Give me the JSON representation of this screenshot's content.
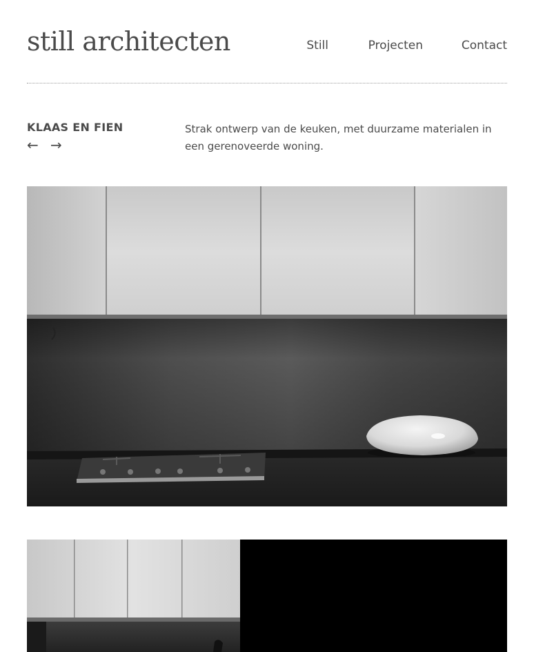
{
  "header": {
    "logo": "still architecten",
    "nav": [
      "Still",
      "Projecten",
      "Contact"
    ]
  },
  "project": {
    "title": "KLAAS EN FIEN",
    "prev_arrow": "←",
    "next_arrow": "→",
    "description": "Strak ontwerp van de keuken, met duurzame materialen in een gerenoveerde woning."
  },
  "images": {
    "photo1_subject": "kitchen-cabinets-cooktop-bowl-bw-photo",
    "photo2_subject": "kitchen-cabinets-bw-photo"
  }
}
